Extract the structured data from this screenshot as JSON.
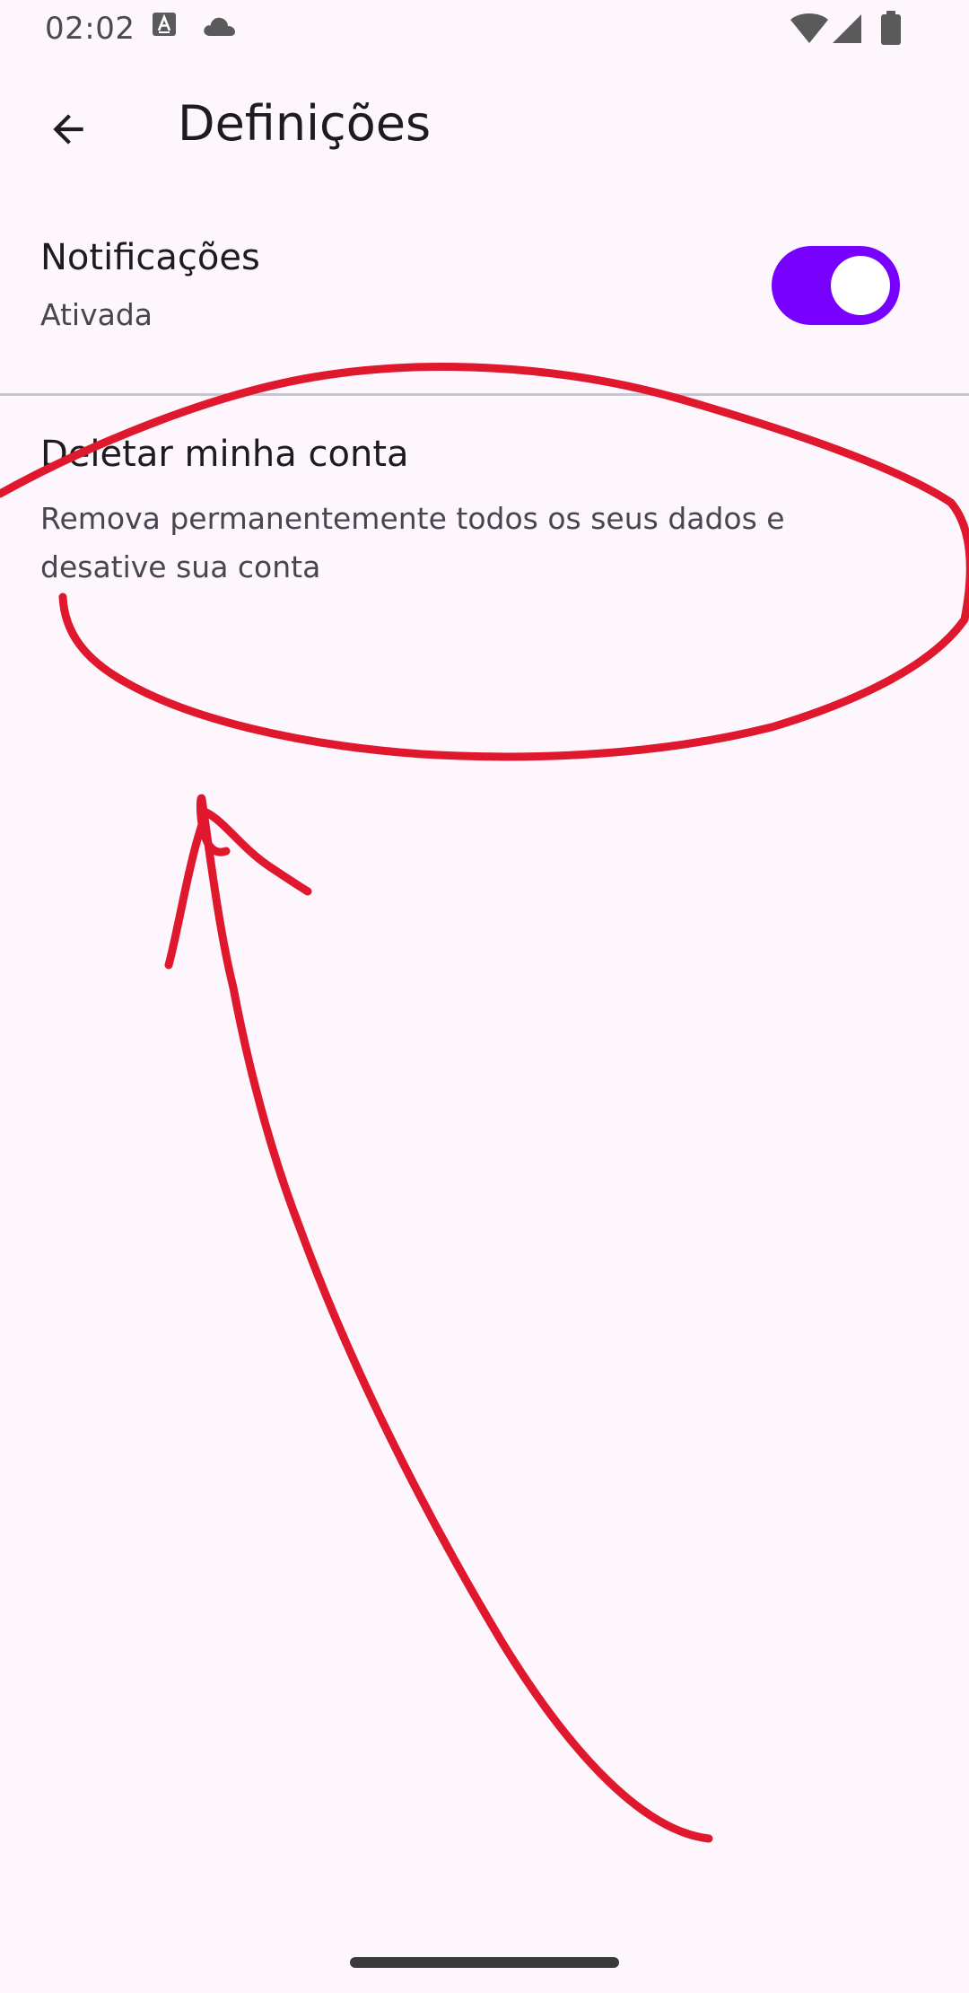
{
  "status_bar": {
    "time": "02:02",
    "icons": [
      "text-a-icon",
      "cloud-icon",
      "wifi-icon",
      "signal-icon",
      "battery-icon"
    ]
  },
  "app_bar": {
    "back_icon": "arrow-back-icon",
    "title": "Definições"
  },
  "settings": {
    "notifications": {
      "title": "Notificações",
      "subtitle": "Ativada",
      "toggle_on": true,
      "toggle_color": "#7700ff"
    },
    "delete_account": {
      "title": "Deletar minha conta",
      "subtitle": "Remova permanentemente todos os seus dados e desative sua conta"
    }
  },
  "annotation": {
    "color": "#e0182e",
    "marks": [
      "ellipse-around-delete-account",
      "arrow-pointing-up"
    ]
  }
}
